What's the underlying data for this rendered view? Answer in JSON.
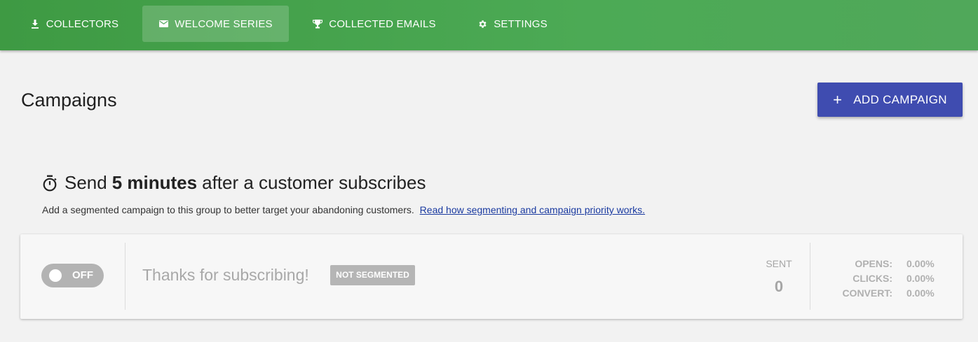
{
  "nav": {
    "tabs": [
      {
        "label": "COLLECTORS",
        "icon": "download-icon"
      },
      {
        "label": "WELCOME SERIES",
        "icon": "envelope-icon",
        "active": true
      },
      {
        "label": "COLLECTED EMAILS",
        "icon": "trophy-icon"
      },
      {
        "label": "SETTINGS",
        "icon": "gear-icon"
      }
    ]
  },
  "header": {
    "title": "Campaigns",
    "add_button_label": "ADD CAMPAIGN"
  },
  "group": {
    "heading_prefix": "Send",
    "heading_delay": "5 minutes",
    "heading_suffix": "after a customer subscribes",
    "note": "Add a segmented campaign to this group to better target your abandoning customers.",
    "note_link": "Read how segmenting and campaign priority works."
  },
  "campaign": {
    "toggle_label": "OFF",
    "name": "Thanks for subscribing!",
    "segment_badge": "NOT SEGMENTED",
    "sent_label": "SENT",
    "sent_value": "0",
    "stats": [
      {
        "label": "OPENS:",
        "value": "0.00%"
      },
      {
        "label": "CLICKS:",
        "value": "0.00%"
      },
      {
        "label": "CONVERT:",
        "value": "0.00%"
      }
    ]
  },
  "colors": {
    "nav_green": "#4caa55",
    "primary_button": "#3f4cb0",
    "link": "#1a3aa0",
    "disabled_gray": "#b3b3b3"
  }
}
